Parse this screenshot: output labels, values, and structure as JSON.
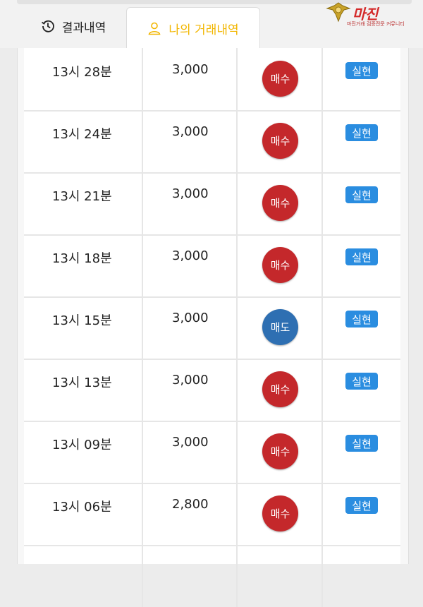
{
  "tabs": {
    "history_label": "결과내역",
    "my_trades_label": "나의 거래내역"
  },
  "logo": {
    "title": "마진",
    "subtitle": "마진거래 검증전문 커뮤니티"
  },
  "colors": {
    "buy": "#c4282b",
    "sell": "#2e6fb2",
    "status": "#2a8de0",
    "active_tab": "#f2b600"
  },
  "rows": [
    {
      "time": "13시 28분",
      "amount": "3,000",
      "type": "매수",
      "status": "실현"
    },
    {
      "time": "13시 24분",
      "amount": "3,000",
      "type": "매수",
      "status": "실현"
    },
    {
      "time": "13시 21분",
      "amount": "3,000",
      "type": "매수",
      "status": "실현"
    },
    {
      "time": "13시 18분",
      "amount": "3,000",
      "type": "매수",
      "status": "실현"
    },
    {
      "time": "13시 15분",
      "amount": "3,000",
      "type": "매도",
      "status": "실현"
    },
    {
      "time": "13시 13분",
      "amount": "3,000",
      "type": "매수",
      "status": "실현"
    },
    {
      "time": "13시 09분",
      "amount": "3,000",
      "type": "매수",
      "status": "실현"
    },
    {
      "time": "13시 06분",
      "amount": "2,800",
      "type": "매수",
      "status": "실현"
    }
  ]
}
